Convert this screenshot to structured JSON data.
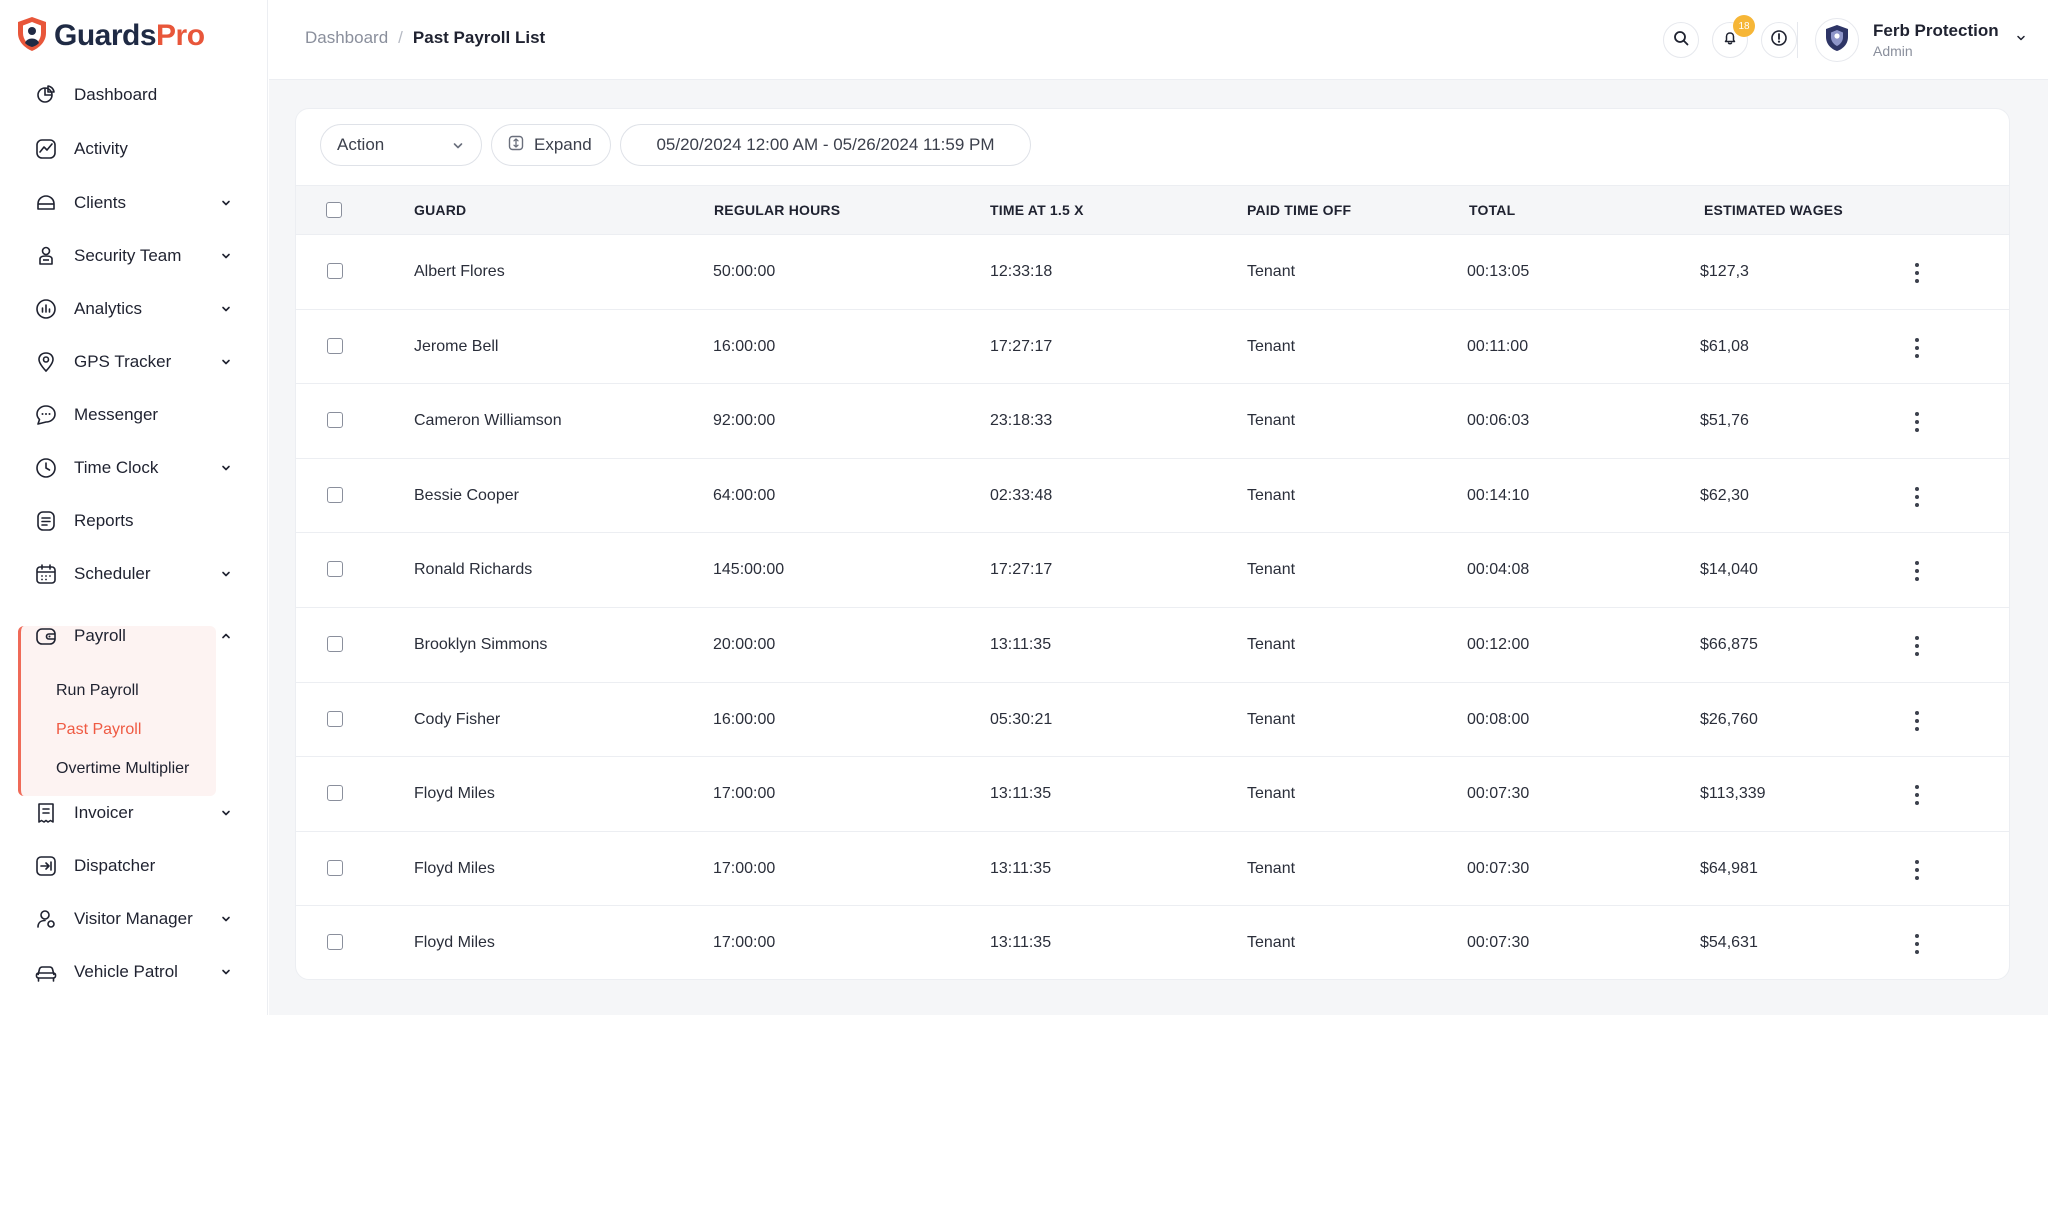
{
  "brand": {
    "part1": "Guards",
    "part2": "Pro"
  },
  "sidebar": {
    "items": [
      {
        "label": "Dashboard",
        "icon": "dashboard-icon",
        "chevron": false
      },
      {
        "label": "Activity",
        "icon": "activity-icon",
        "chevron": false
      },
      {
        "label": "Clients",
        "icon": "clients-icon",
        "chevron": true
      },
      {
        "label": "Security Team",
        "icon": "security-team-icon",
        "chevron": true
      },
      {
        "label": "Analytics",
        "icon": "analytics-icon",
        "chevron": true
      },
      {
        "label": "GPS Tracker",
        "icon": "gps-icon",
        "chevron": true
      },
      {
        "label": "Messenger",
        "icon": "messenger-icon",
        "chevron": false
      },
      {
        "label": "Time Clock",
        "icon": "clock-icon",
        "chevron": true
      },
      {
        "label": "Reports",
        "icon": "reports-icon",
        "chevron": false
      },
      {
        "label": "Scheduler",
        "icon": "calendar-icon",
        "chevron": true
      },
      {
        "label": "Payroll",
        "icon": "wallet-icon",
        "chevron": true
      },
      {
        "label": "Invoicer",
        "icon": "invoice-icon",
        "chevron": true
      },
      {
        "label": "Dispatcher",
        "icon": "dispatcher-icon",
        "chevron": false
      },
      {
        "label": "Visitor Manager",
        "icon": "visitor-icon",
        "chevron": true
      },
      {
        "label": "Vehicle Patrol",
        "icon": "car-icon",
        "chevron": true
      }
    ],
    "payroll_sub": [
      {
        "label": "Run Payroll",
        "active": false
      },
      {
        "label": "Past Payroll",
        "active": true
      },
      {
        "label": "Overtime Multiplier",
        "active": false
      }
    ]
  },
  "breadcrumb": {
    "parent": "Dashboard",
    "separator": "/",
    "current": "Past Payroll List"
  },
  "header": {
    "notification_count": "18",
    "user_name": "Ferb Protection",
    "user_role": "Admin"
  },
  "toolbar": {
    "action_label": "Action",
    "expand_label": "Expand",
    "date_range": "05/20/2024 12:00 AM - 05/26/2024 11:59 PM"
  },
  "table": {
    "columns": [
      "GUARD",
      "REGULAR HOURS",
      "TIME AT 1.5 X",
      "PAID TIME OFF",
      "TOTAL",
      "ESTIMATED WAGES"
    ],
    "rows": [
      [
        "Albert Flores",
        "50:00:00",
        "12:33:18",
        "Tenant",
        "00:13:05",
        "$127,3"
      ],
      [
        "Jerome Bell",
        "16:00:00",
        "17:27:17",
        "Tenant",
        "00:11:00",
        "$61,08"
      ],
      [
        "Cameron Williamson",
        "92:00:00",
        "23:18:33",
        "Tenant",
        "00:06:03",
        "$51,76"
      ],
      [
        "Bessie Cooper",
        "64:00:00",
        "02:33:48",
        "Tenant",
        "00:14:10",
        "$62,30"
      ],
      [
        "Ronald Richards",
        "145:00:00",
        "17:27:17",
        "Tenant",
        "00:04:08",
        "$14,040"
      ],
      [
        "Brooklyn Simmons",
        "20:00:00",
        "13:11:35",
        "Tenant",
        "00:12:00",
        "$66,875"
      ],
      [
        "Cody Fisher",
        "16:00:00",
        "05:30:21",
        "Tenant",
        "00:08:00",
        "$26,760"
      ],
      [
        "Floyd Miles",
        "17:00:00",
        "13:11:35",
        "Tenant",
        "00:07:30",
        "$113,339"
      ],
      [
        "Floyd Miles",
        "17:00:00",
        "13:11:35",
        "Tenant",
        "00:07:30",
        "$64,981"
      ],
      [
        "Floyd Miles",
        "17:00:00",
        "13:11:35",
        "Tenant",
        "00:07:30",
        "$54,631"
      ]
    ]
  },
  "colors": {
    "accent": "#ef5a43",
    "brand_dark": "#1f2a44",
    "badge": "#f6b637"
  }
}
